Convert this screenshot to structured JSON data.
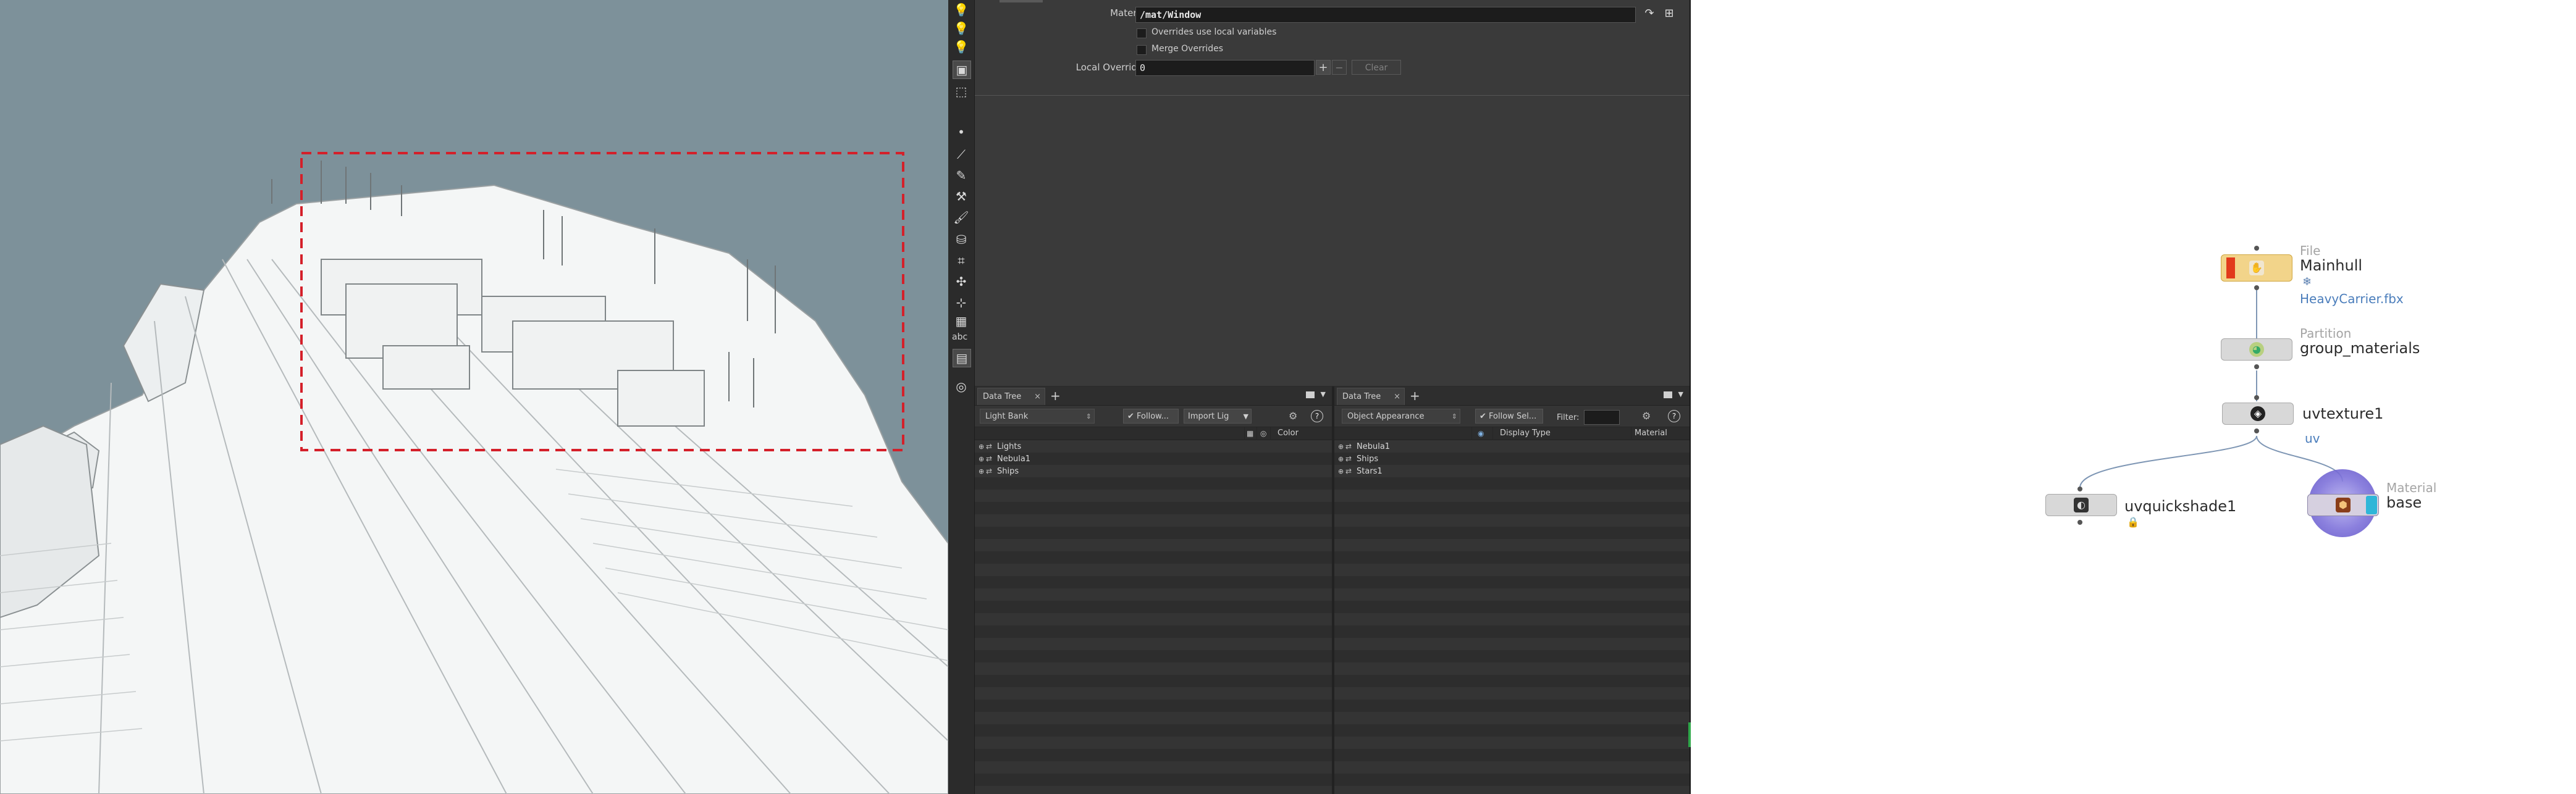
{
  "viewport": {
    "name": "3D viewport",
    "selection_box_color": "#d4202a",
    "background_color": "#7d919a"
  },
  "shelf": {
    "tools": [
      "light-icon",
      "light-icon",
      "light-icon",
      "camera-icon",
      "select-icon",
      "vertex-icon",
      "edge-icon",
      "paint-icon",
      "sculpt-icon",
      "brush-icon",
      "stamp-icon",
      "crop-icon",
      "transform-icon",
      "pivot-icon",
      "grid-icon"
    ],
    "abc_label": "abc"
  },
  "params": {
    "material_label": "Material",
    "material_value": "/mat/Window",
    "overrides_local_label": "Overrides use local variables",
    "merge_overrides_label": "Merge Overrides",
    "local_overrides_label": "Local Overrides",
    "local_overrides_value": "0",
    "plus_label": "+",
    "minus_label": "−",
    "clear_label": "Clear"
  },
  "left_tree": {
    "tab_label": "Data Tree",
    "tab_close": "×",
    "add_tab": "+",
    "view_select": "Light Bank",
    "follow_label": "Follow...",
    "import_label": "Import Lig",
    "help": "?",
    "columns": [
      "Color"
    ],
    "rows": [
      "Lights",
      "Nebula1",
      "Ships"
    ]
  },
  "right_tree": {
    "tab_label": "Data Tree",
    "tab_close": "×",
    "add_tab": "+",
    "view_select": "Object Appearance",
    "follow_label": "Follow Sel...",
    "filter_label": "Filter:",
    "help": "?",
    "columns": [
      "Display Type",
      "Material"
    ],
    "rows": [
      "Nebula1",
      "Ships",
      "Stars1"
    ]
  },
  "network": {
    "nodes": [
      {
        "type": "File",
        "name": "Mainhull",
        "sub": "HeavyCarrier.fbx",
        "flag": "❄"
      },
      {
        "type": "Partition",
        "name": "group_materials"
      },
      {
        "type": "",
        "name": "uvtexture1",
        "sub": "uv"
      },
      {
        "type": "",
        "name": "uvquickshade1",
        "flag": "🔒"
      },
      {
        "type": "Material",
        "name": "base"
      }
    ],
    "highlight_color": "#4a7dbb",
    "material_ring_color": "#6b5fc7"
  }
}
